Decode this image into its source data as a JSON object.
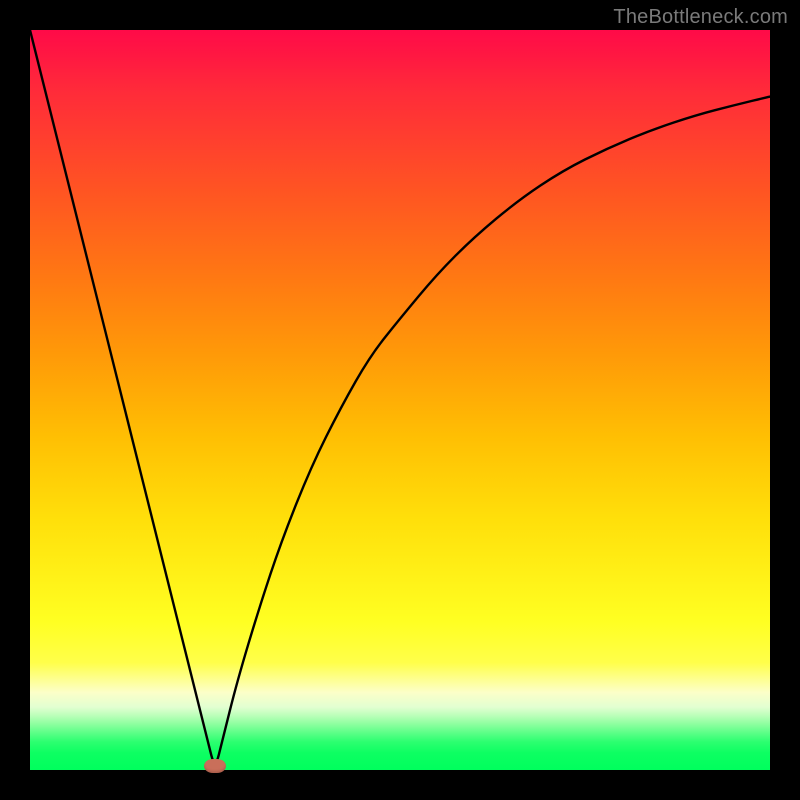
{
  "watermark": "TheBottleneck.com",
  "colors": {
    "frame": "#000000",
    "curve": "#000000",
    "bump": "#c96f5a"
  },
  "chart_data": {
    "type": "line",
    "title": "",
    "xlabel": "",
    "ylabel": "",
    "xlim": [
      0,
      100
    ],
    "ylim": [
      0,
      100
    ],
    "grid": false,
    "legend": false,
    "annotations": [],
    "series": [
      {
        "name": "bottleneck-curve",
        "x": [
          0,
          4,
          8,
          12,
          16,
          20,
          22,
          24,
          25,
          26,
          28,
          31,
          34,
          38,
          42,
          46,
          50,
          55,
          60,
          66,
          72,
          78,
          84,
          90,
          95,
          100
        ],
        "y": [
          100,
          84,
          68,
          52,
          36,
          20,
          12,
          4,
          0,
          4,
          12,
          22,
          31,
          41,
          49,
          56,
          61,
          67,
          72,
          77,
          81,
          84,
          86.5,
          88.5,
          89.8,
          91
        ]
      }
    ],
    "marker": {
      "x": 25,
      "y": 0,
      "shape": "ellipse",
      "color": "#c96f5a"
    },
    "notes": "V-shaped bottleneck curve on a red-to-green vertical gradient. Minimum at x≈25. Values y are percentage of vertical range measured from bottom (0) to top (100), estimated from pixel positions."
  }
}
